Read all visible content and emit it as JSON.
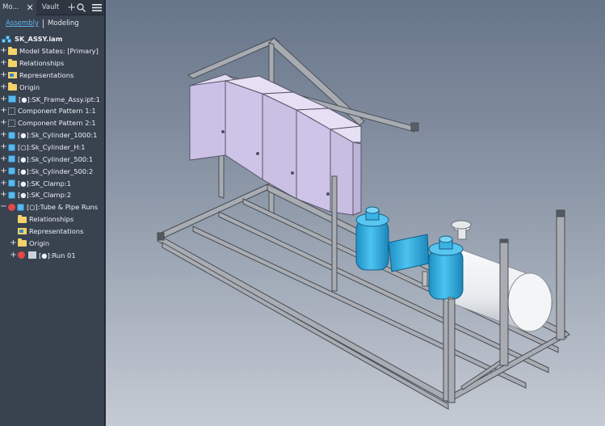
{
  "browser": {
    "tabs": [
      {
        "label": "Mo..."
      },
      {
        "label": "Vault"
      }
    ],
    "icons": {
      "close": "close-icon",
      "add": "plus-icon",
      "search": "search-icon",
      "menu": "menu-icon"
    },
    "modes": {
      "assembly": "Assembly",
      "modeling": "Modeling"
    },
    "tree": [
      {
        "label": "SK_ASSY.iam",
        "icon": "assembly-root-icon",
        "expander": ""
      },
      {
        "label": "Model States: [Primary]",
        "icon": "folder-icon",
        "expander": "+"
      },
      {
        "label": "Relationships",
        "icon": "folder-icon",
        "expander": "+"
      },
      {
        "label": "Representations",
        "icon": "representations-icon",
        "expander": "+"
      },
      {
        "label": "Origin",
        "icon": "folder-icon",
        "expander": "+"
      },
      {
        "label": "[●]:SK_Frame_Assy.ipt:1",
        "icon": "frame-part-icon",
        "expander": "+"
      },
      {
        "label": "Component Pattern 1:1",
        "icon": "pattern-icon",
        "expander": "+"
      },
      {
        "label": "Component Pattern 2:1",
        "icon": "pattern-icon",
        "expander": "+"
      },
      {
        "label": "[●]:Sk_Cylinder_1000:1",
        "icon": "part-icon",
        "expander": "+"
      },
      {
        "label": "[○]:Sk_Cylinder_H:1",
        "icon": "part-icon",
        "expander": "+"
      },
      {
        "label": "[●]:Sk_Cylinder_500:1",
        "icon": "part-icon",
        "expander": "+"
      },
      {
        "label": "[●]:Sk_Cylinder_500:2",
        "icon": "part-icon",
        "expander": "+"
      },
      {
        "label": "[●]:SK_Clamp:1",
        "icon": "part-icon",
        "expander": "+"
      },
      {
        "label": "[●]:SK_Clamp:2",
        "icon": "part-icon",
        "expander": "+"
      },
      {
        "label": "[○]:Tube & Pipe Runs",
        "icon": "tube-pipe-icon",
        "expander": "−"
      },
      {
        "label": "Relationships",
        "icon": "folder-icon",
        "expander": ""
      },
      {
        "label": "Representations",
        "icon": "representations-icon",
        "expander": ""
      },
      {
        "label": "Origin",
        "icon": "folder-icon",
        "expander": "+"
      },
      {
        "label": "[●]:Run 01",
        "icon": "run-icon",
        "expander": "+"
      }
    ]
  },
  "colors": {
    "panel_bg": "#39424f",
    "accent": "#5fb4f0",
    "frame_steel": "#a9adb3",
    "cabinet": "#c9bde6",
    "cylinder_blue": "#3ab4e6",
    "tank_white": "#eef0f2"
  }
}
